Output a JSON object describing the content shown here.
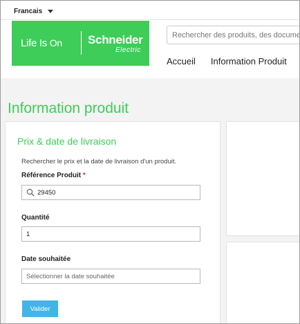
{
  "topbar": {
    "language": "Francais"
  },
  "header": {
    "logo": {
      "tagline_prefix": "Life Is ",
      "tagline_on": "On",
      "brand": "Schneider",
      "brand_sub": "Electric"
    },
    "search_placeholder": "Rechercher des produits, des documents",
    "nav": [
      "Accueil",
      "Information Produit"
    ]
  },
  "page": {
    "title": "Information produit",
    "form": {
      "title": "Prix & date de livraison",
      "description": "Rechercher le prix et la date de livraison d'un produit.",
      "reference_label": "Référence Produit",
      "required_mark": "*",
      "reference_value": "29450",
      "quantity_label": "Quantité",
      "quantity_value": "1",
      "date_label": "Date souhaitée",
      "date_placeholder": "Sélectionner la date souhaitée",
      "submit_label": "Valider"
    }
  },
  "colors": {
    "brand_green": "#3dcd58",
    "button_blue": "#42b4e6",
    "required_red": "#e0301e"
  }
}
